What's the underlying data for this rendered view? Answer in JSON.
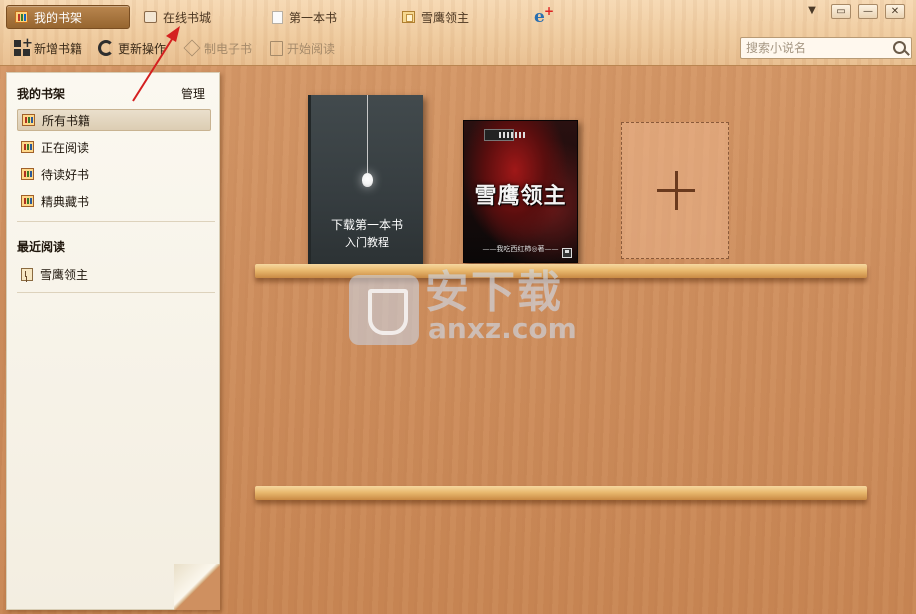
{
  "tabs": [
    {
      "label": "我的书架",
      "icon": "bookshelf-icon",
      "active": true
    },
    {
      "label": "在线书城",
      "icon": "online-store-icon",
      "active": false
    },
    {
      "label": "第一本书",
      "icon": "page-icon",
      "active": false
    },
    {
      "label": "雪鹰领主",
      "icon": "book-icon",
      "active": false
    }
  ],
  "toolbar": {
    "add_book": "新增书籍",
    "update": "更新操作",
    "make_ebook": "制电子书",
    "start_reading": "开始阅读"
  },
  "search": {
    "placeholder": "搜索小说名"
  },
  "window_controls": {
    "menu": "▼",
    "restore": "▭",
    "minimize": "—",
    "close": "✕"
  },
  "sidebar": {
    "shelf_title": "我的书架",
    "manage": "管理",
    "items": [
      {
        "label": "所有书籍",
        "selected": true
      },
      {
        "label": "正在阅读",
        "selected": false
      },
      {
        "label": "待读好书",
        "selected": false
      },
      {
        "label": "精典藏书",
        "selected": false
      }
    ],
    "recent_title": "最近阅读",
    "recent_items": [
      {
        "label": "雪鹰领主"
      }
    ]
  },
  "books": [
    {
      "title": "下载第一本书",
      "subtitle": "入门教程"
    },
    {
      "title": "雪鹰领主",
      "author": "——我吃西红柿◎著——"
    }
  ],
  "add_book_slot": {
    "symbol": "+"
  },
  "watermark": {
    "text": "安下载",
    "domain": "anxz.com"
  },
  "colors": {
    "active_tab": "#a7743d",
    "annotation_arrow": "#d42020"
  }
}
